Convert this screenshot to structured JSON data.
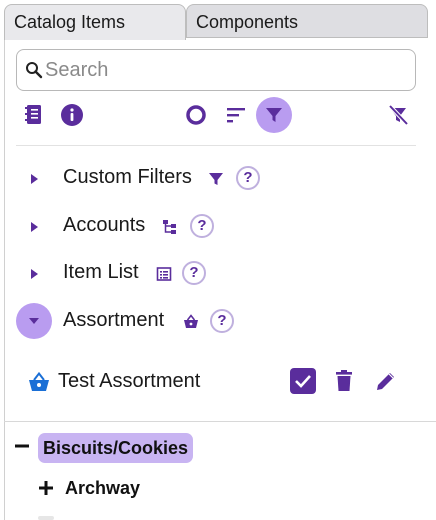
{
  "tabs": [
    {
      "label": "Catalog Items",
      "active": true
    },
    {
      "label": "Components",
      "active": false
    }
  ],
  "search": {
    "placeholder": "Search",
    "value": ""
  },
  "toolbar": {
    "icons": [
      "catalog-list-icon",
      "info-icon",
      "circle-outline-icon",
      "sort-icon",
      "filter-icon",
      "clear-filter-icon"
    ],
    "active_icon": "filter-icon"
  },
  "sections": [
    {
      "label": "Custom Filters",
      "icon": "filter-icon",
      "expanded": false,
      "help": "?"
    },
    {
      "label": "Accounts",
      "icon": "hierarchy-icon",
      "expanded": false,
      "help": "?"
    },
    {
      "label": "Item List",
      "icon": "list-table-icon",
      "expanded": false,
      "help": "?"
    },
    {
      "label": "Assortment",
      "icon": "basket-icon",
      "expanded": true,
      "help": "?"
    }
  ],
  "assortment_item": {
    "label": "Test Assortment",
    "icon": "basket-icon",
    "checked": true,
    "actions": [
      "checkbox-icon",
      "delete-icon",
      "edit-icon"
    ]
  },
  "tree": [
    {
      "label": "Biscuits/Cookies",
      "sign": "−",
      "highlighted": true
    },
    {
      "label": "Archway",
      "sign": "+",
      "highlighted": false
    }
  ],
  "colors": {
    "accent": "#5a2d9c",
    "accent_light": "#b99cf0",
    "chip": "#c8b4f2",
    "basket_blue": "#1a6fd6"
  }
}
